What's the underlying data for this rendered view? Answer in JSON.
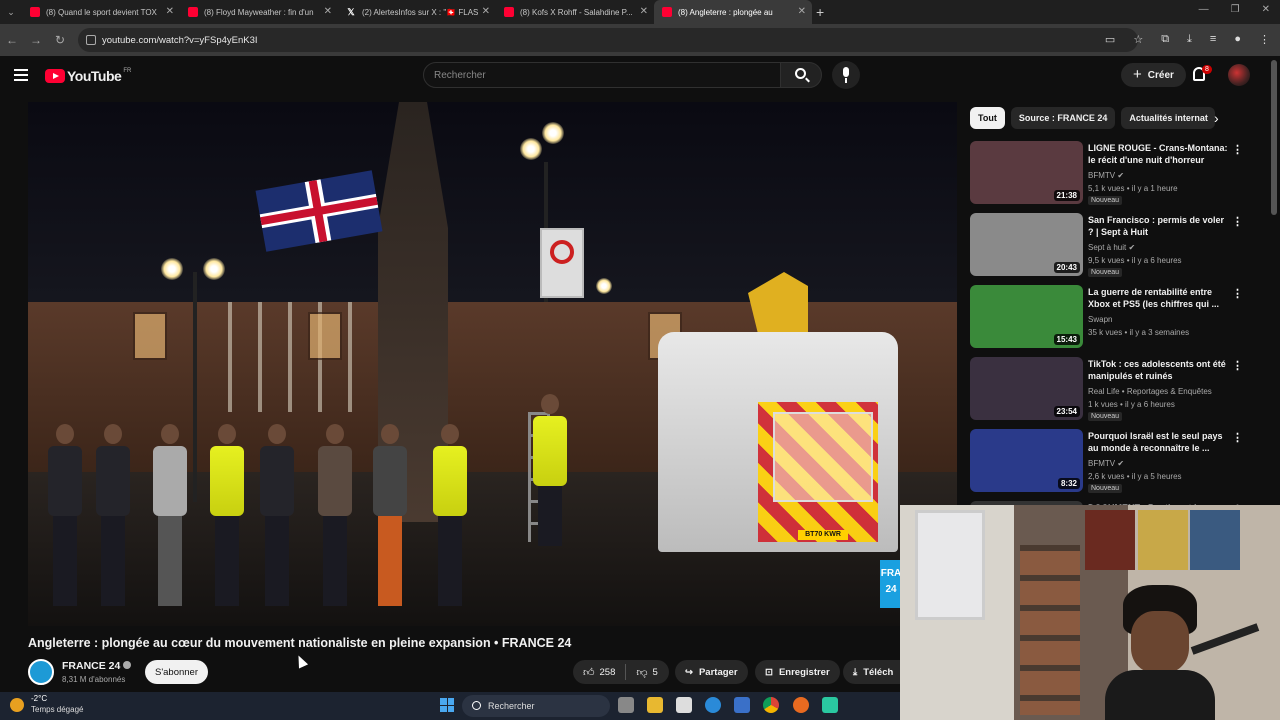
{
  "browser": {
    "tabs": [
      {
        "label": "(8) Quand le sport devient TOX",
        "icon": "youtube-icon"
      },
      {
        "label": "(8) Floyd Mayweather : fin d'un",
        "icon": "youtube-icon"
      },
      {
        "label": "(2) AlertesInfos sur X : \"🇨🇭 FLAS",
        "icon": "x-icon"
      },
      {
        "label": "(8) Kofs X Rohff - Salahdine P...",
        "icon": "youtube-icon"
      },
      {
        "label": "(8) Angleterre : plongée au",
        "icon": "youtube-icon",
        "active": true
      }
    ],
    "url": "youtube.com/watch?v=yFSp4yEnK3I",
    "new_tab": "+"
  },
  "youtube": {
    "logo_text": "YouTube",
    "region": "FR",
    "search_placeholder": "Rechercher",
    "create_label": "Créer",
    "notification_count": "8"
  },
  "video": {
    "title": "Angleterre : plongée au cœur du mouvement nationaliste en pleine expansion • FRANCE 24",
    "channel": "FRANCE 24",
    "subscribers": "8,31 M d'abonnés",
    "subscribe_label": "S'abonner",
    "likes": "258",
    "dislikes": "5",
    "share_label": "Partager",
    "save_label": "Enregistrer",
    "download_label": "Téléch",
    "scene": {
      "plate": "BT70 KWR",
      "watermark": "FRA\n24"
    }
  },
  "chips": [
    "Tout",
    "Source : FRANCE 24",
    "Actualités internat"
  ],
  "related": [
    {
      "title": "LIGNE ROUGE - Crans-Montana: le récit d'une nuit d'horreur",
      "channel": "BFMTV",
      "verified": true,
      "meta": "5,1 k vues • il y a 1 heure",
      "duration": "21:38",
      "new": "Nouveau",
      "thumb": "#5a3a40"
    },
    {
      "title": "San Francisco : permis de voler ? | Sept à Huit",
      "channel": "Sept à huit",
      "verified": true,
      "meta": "9,5 k vues • il y a 6 heures",
      "duration": "20:43",
      "new": "Nouveau",
      "thumb": "#8a8a8a"
    },
    {
      "title": "La guerre de rentabilité entre Xbox et PS5 (les chiffres qui ...",
      "channel": "Swapn",
      "verified": false,
      "meta": "35 k vues • il y a 3 semaines",
      "duration": "15:43",
      "new": "",
      "thumb": "#3a8a3a"
    },
    {
      "title": "TikTok : ces adolescents ont été manipulés et ruinés",
      "channel": "Real Life • Reportages & Enquêtes",
      "verified": false,
      "meta": "1 k vues • il y a 6 heures",
      "duration": "23:54",
      "new": "Nouveau",
      "thumb": "#3a3040"
    },
    {
      "title": "Pourquoi Israël est le seul pays au monde à reconnaître le ...",
      "channel": "BFMTV",
      "verified": true,
      "meta": "2,6 k vues • il y a 5 heures",
      "duration": "8:32",
      "new": "Nouveau",
      "thumb": "#2a3a8a"
    },
    {
      "title": "DOCUMENT - Poutine et les ...",
      "channel": "",
      "verified": false,
      "meta": "",
      "duration": "",
      "new": "",
      "thumb": "#333"
    }
  ],
  "taskbar": {
    "temperature": "-2°C",
    "weather": "Temps dégagé",
    "search_label": "Rechercher"
  }
}
